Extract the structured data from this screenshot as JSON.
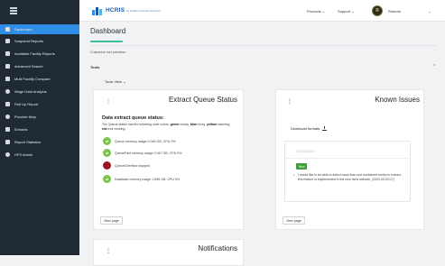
{
  "sidebar": {
    "items": [
      {
        "label": "Dashboard",
        "icon": "dashboard-icon"
      },
      {
        "label": "Snapshot Reports",
        "icon": "report-icon"
      },
      {
        "label": "Available Facility Reports",
        "icon": "facility-icon"
      },
      {
        "label": "Advanced Search",
        "icon": "search-icon"
      },
      {
        "label": "Multi Facility Compare",
        "icon": "compare-icon"
      },
      {
        "label": "Wage Data Analysis",
        "icon": "wage-icon"
      },
      {
        "label": "Roll Up Report",
        "icon": "rollup-icon"
      },
      {
        "label": "Provider Map",
        "icon": "map-pin-icon"
      },
      {
        "label": "Extracts",
        "icon": "extract-icon"
      },
      {
        "label": "Report Statistics",
        "icon": "stats-icon"
      },
      {
        "label": "HFS Admin",
        "icon": "admin-icon"
      }
    ]
  },
  "header": {
    "logo_text": "HCRIS",
    "logo_sub": "by Health Financial Systems",
    "nav": {
      "products": "Products ⌄",
      "support": "Support ⌄",
      "user": "Roberto",
      "user_caret": "⌄"
    },
    "avatar_initial": "R"
  },
  "main": {
    "title": "Dashboard",
    "subtitle": "Customize tool previews.",
    "tools_label": "Tools",
    "tools_view": "Tools View ⌄",
    "collapse_symbol": "^"
  },
  "cards": {
    "extract_queue": {
      "title": "Extract Queue Status",
      "heading": "Data extract queue status:",
      "desc_prefix": "The Queue status has the following code colors: ",
      "desc_green": "green",
      "desc_mid1": "=ready, ",
      "desc_blue": "blue",
      "desc_mid2": "=busy, ",
      "desc_yellow": "yellow",
      "desc_mid3": "=warning, ",
      "desc_red": "red",
      "desc_end": "=not working.",
      "statuses": [
        {
          "text": "Queue memory usage 0.046 GB, CPU 0%",
          "color": "green"
        },
        {
          "text": "QueueFast memory usage 0.047 GB, CPU 0%",
          "color": "green"
        },
        {
          "text": "QueueOverflow stopped",
          "color": "red"
        },
        {
          "text": "Database memory usage 1.698 GB, CPU 0%",
          "color": "green"
        }
      ],
      "view_button": "View page"
    },
    "known_issues": {
      "title": "Known Issues",
      "download_label": "Download formats",
      "issue_date": "10/03/2019",
      "badge": "New",
      "issue_text": "I would like to be able to select more than one worksheet series to extract - this feature is implemented in the new hcris website. (2020-00-02/17)",
      "view_button": "View page"
    },
    "notifications": {
      "title": "Notifications"
    }
  },
  "colors": {
    "sidebar_bg": "#1f2a35",
    "active": "#2f8ee6",
    "accent": "#3bbf9a",
    "status_green": "#7cc24e",
    "status_red": "#9b1522"
  }
}
